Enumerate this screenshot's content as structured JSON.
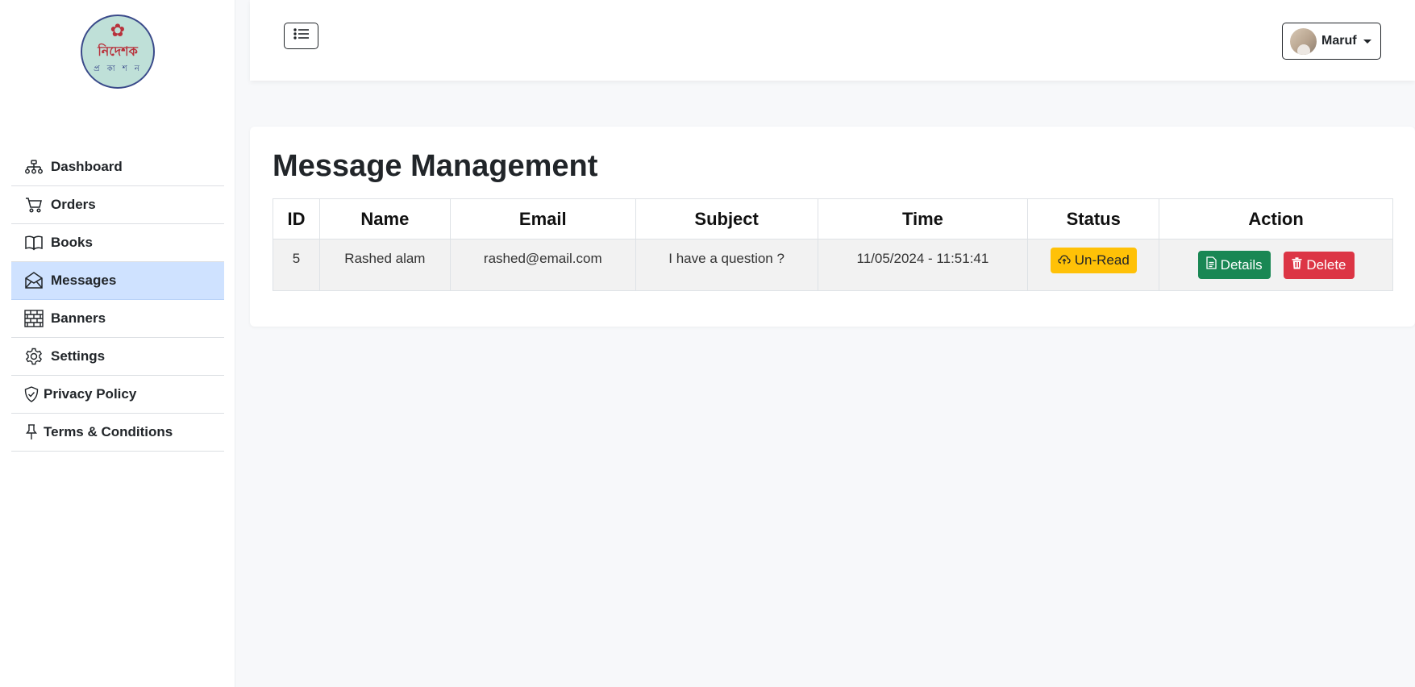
{
  "sidebar": {
    "logo": {
      "main_text": "নিদেশক",
      "sub_text": "প্র কা শ ন"
    },
    "items": [
      {
        "label": "Dashboard",
        "icon": "sitemap-icon"
      },
      {
        "label": "Orders",
        "icon": "cart-icon"
      },
      {
        "label": "Books",
        "icon": "book-icon"
      },
      {
        "label": "Messages",
        "icon": "envelope-icon",
        "active": true
      },
      {
        "label": "Banners",
        "icon": "bricks-icon"
      },
      {
        "label": "Settings",
        "icon": "gear-icon"
      },
      {
        "label": "Privacy Policy",
        "icon": "shield-check-icon"
      },
      {
        "label": "Terms & Conditions",
        "icon": "pin-icon"
      }
    ]
  },
  "header": {
    "menu_toggle_icon": "list-icon",
    "user": {
      "name": "Maruf",
      "avatar_icon": "avatar"
    }
  },
  "main": {
    "title": "Message Management",
    "table": {
      "columns": [
        "ID",
        "Name",
        "Email",
        "Subject",
        "Time",
        "Status",
        "Action"
      ],
      "rows": [
        {
          "id": "5",
          "name": "Rashed alam",
          "email": "rashed@email.com",
          "subject": "I have a question ?",
          "time": "11/05/2024 - 11:51:41",
          "status": "Un-Read",
          "actions": {
            "details": "Details",
            "delete": "Delete"
          }
        }
      ]
    }
  },
  "colors": {
    "active_nav": "#cfe2ff",
    "status_unread": "#ffc107",
    "details_button": "#198754",
    "delete_button": "#dc3545"
  }
}
